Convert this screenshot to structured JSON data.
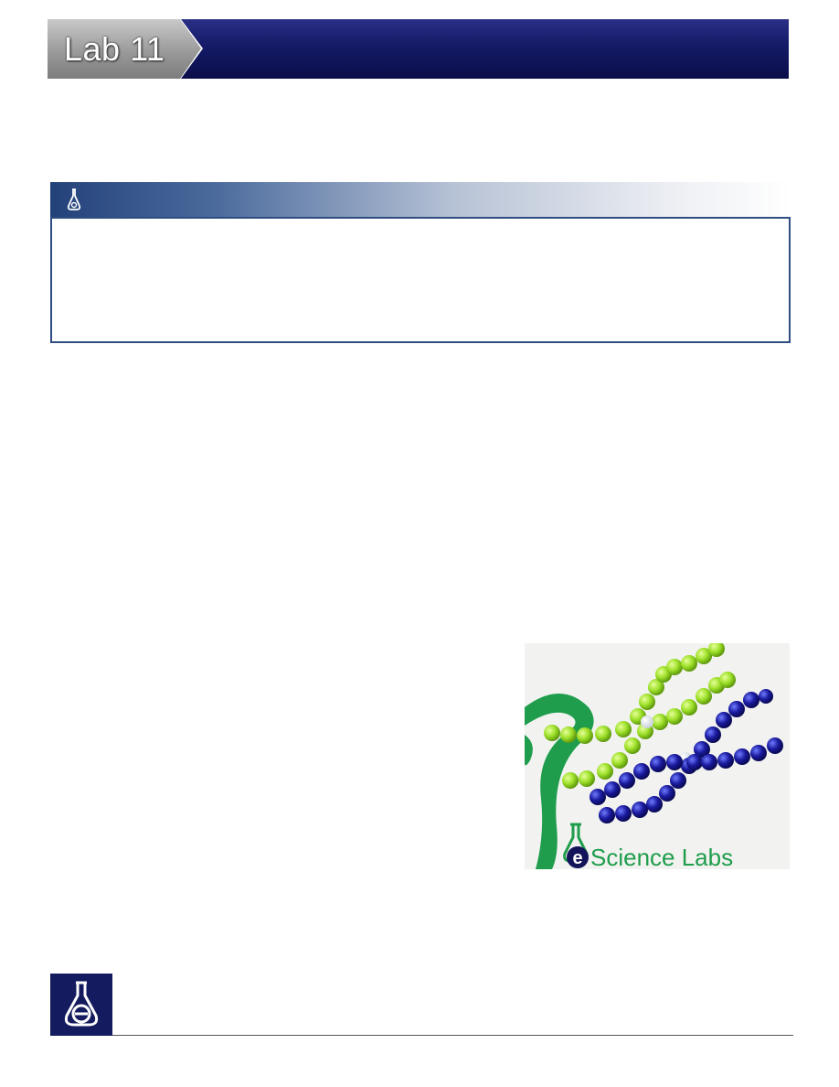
{
  "header": {
    "lab_label": "Lab 11"
  },
  "objective_box": {
    "icon": "flask-icon"
  },
  "photo": {
    "logo_text": "Science Labs",
    "logo_letter": "e"
  },
  "footer": {
    "logo_icon": "flask-e-logo-icon"
  },
  "colors": {
    "banner_navy": "#141a66",
    "box_border": "#2f4d80",
    "bead_green": "#9ee02a",
    "bead_blue": "#1a1a9e",
    "logo_green": "#1f9d4c"
  }
}
